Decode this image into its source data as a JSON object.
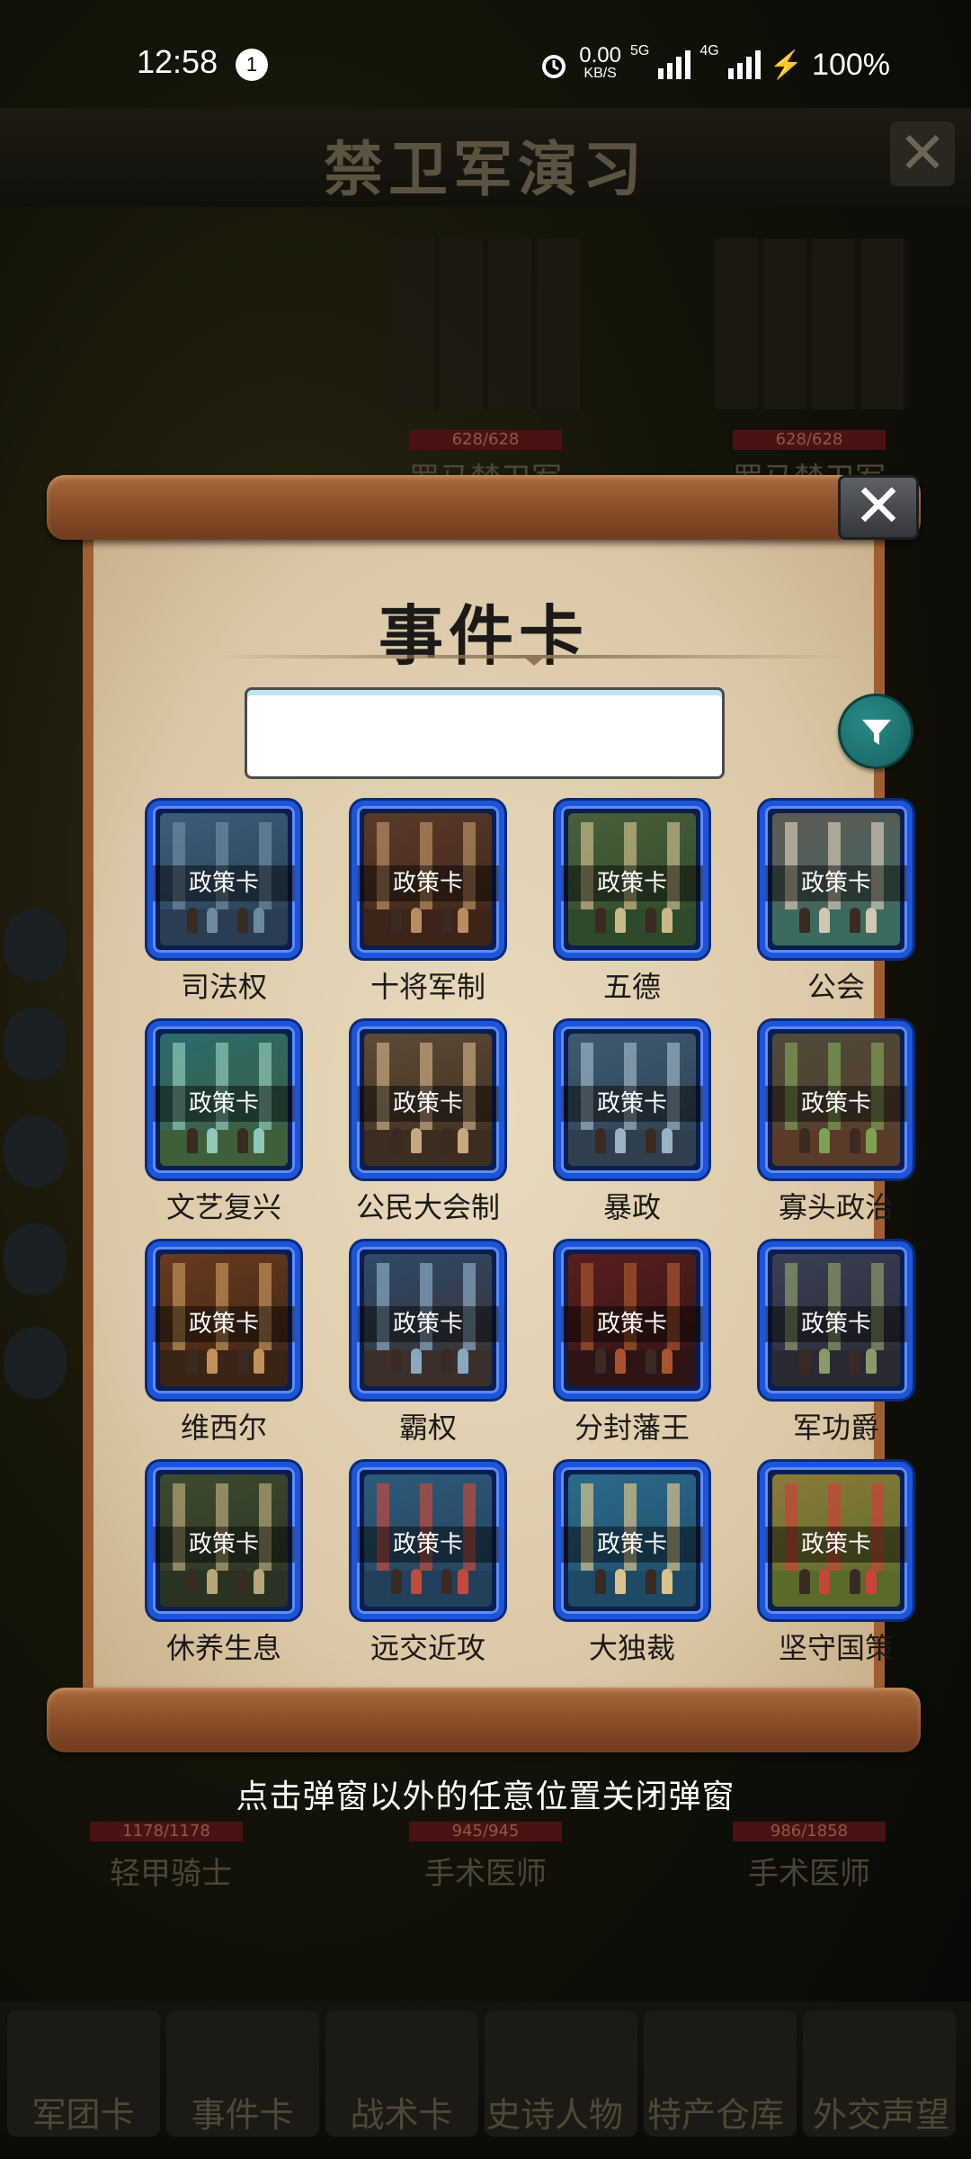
{
  "status_bar": {
    "time": "12:58",
    "notification_count": "1",
    "net_speed_value": "0.00",
    "net_speed_unit": "KB/S",
    "network_5g": "5G",
    "network_4g": "4G",
    "battery": "100%"
  },
  "background": {
    "title": "禁卫军演习",
    "units_top": [
      {
        "hp": "628/628",
        "name": "罗马禁卫军"
      },
      {
        "hp": "628/628",
        "name": "罗马禁卫军"
      }
    ],
    "units_bottom": [
      {
        "hp": "1178/1178",
        "name": "轻甲骑士"
      },
      {
        "hp": "945/945",
        "name": "手术医师"
      },
      {
        "hp": "986/1858",
        "name": "手术医师"
      }
    ],
    "bottom_nav": [
      "军团卡",
      "事件卡",
      "战术卡",
      "史诗人物",
      "特产仓库",
      "外交声望"
    ]
  },
  "modal": {
    "title": "事件卡",
    "search": {
      "value": "",
      "placeholder": ""
    },
    "card_tag": "政策卡",
    "cards": [
      {
        "name": "司法权",
        "palette": [
          "#3b5d7a",
          "#6e8b9e",
          "#2a3d52"
        ]
      },
      {
        "name": "十将军制",
        "palette": [
          "#5a3b2a",
          "#b98d62",
          "#3d2418"
        ]
      },
      {
        "name": "五德",
        "palette": [
          "#4a5e3a",
          "#c9b98a",
          "#2e4a2a"
        ]
      },
      {
        "name": "公会",
        "palette": [
          "#5d5a55",
          "#d2c7b2",
          "#3a6b5e"
        ]
      },
      {
        "name": "文艺复兴",
        "palette": [
          "#2b6a6e",
          "#8fc7b8",
          "#3f5e3a"
        ]
      },
      {
        "name": "公民大会制",
        "palette": [
          "#5e4a36",
          "#c7a981",
          "#3d2c20"
        ]
      },
      {
        "name": "暴政",
        "palette": [
          "#3e5a70",
          "#9bb2c2",
          "#2f3f4f"
        ]
      },
      {
        "name": "寡头政治",
        "palette": [
          "#4d4a3a",
          "#7da055",
          "#5a3b2a"
        ]
      },
      {
        "name": "维西尔",
        "palette": [
          "#6a3a1e",
          "#c0925a",
          "#3a2416"
        ]
      },
      {
        "name": "霸权",
        "palette": [
          "#2f4a6a",
          "#8aa8c2",
          "#3a2f2a"
        ]
      },
      {
        "name": "分封藩王",
        "palette": [
          "#5a1e1e",
          "#a8552e",
          "#2e1414"
        ]
      },
      {
        "name": "军功爵",
        "palette": [
          "#3a3f55",
          "#8a9b6a",
          "#2a2a33"
        ]
      },
      {
        "name": "休养生息",
        "palette": [
          "#3d4a2f",
          "#b7a678",
          "#2a3322"
        ]
      },
      {
        "name": "远交近攻",
        "palette": [
          "#2e5a7a",
          "#c24a3a",
          "#23405a"
        ]
      },
      {
        "name": "大独裁",
        "palette": [
          "#2d6a8a",
          "#d9c38a",
          "#1e4a66"
        ]
      },
      {
        "name": "坚守国策",
        "palette": [
          "#8a7a3a",
          "#c9433a",
          "#5a6a2a"
        ]
      }
    ]
  },
  "close_hint": "点击弹窗以外的任意位置关闭弹窗",
  "icons": {
    "close": "close-icon",
    "filter": "filter-icon",
    "alarm": "alarm-icon",
    "signal": "signal-icon",
    "battery": "battery-icon"
  },
  "colors": {
    "card_border": "#1d55d8",
    "filter_button": "#1a6f6b",
    "parchment": "#e9dbc0",
    "scroll_wood": "#8a4f28"
  }
}
